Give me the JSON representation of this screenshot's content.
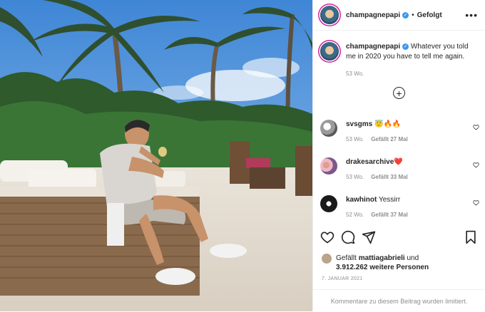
{
  "header": {
    "username": "champagnepapi",
    "separator": "•",
    "follow_status": "Gefolgt",
    "more_icon": "more-dots-icon"
  },
  "caption": {
    "username": "champagnepapi",
    "text": "Whatever you told me in 2020 you have to tell me again.",
    "time": "53 Wo."
  },
  "load_more_icon": "plus-circle-icon",
  "comments": [
    {
      "username": "svsgms",
      "text": "😇🔥🔥",
      "time": "53 Wo.",
      "likes": "Gefällt 27 Mal"
    },
    {
      "username": "drakesarchive",
      "text": "❤️",
      "time": "53 Wo.",
      "likes": "Gefällt 33 Mal"
    },
    {
      "username": "kawhinot",
      "text": "Yessirr",
      "time": "52 Wo.",
      "likes": "Gefällt 37 Mal"
    }
  ],
  "actions": {
    "like_icon": "heart-icon",
    "comment_icon": "comment-icon",
    "share_icon": "share-icon",
    "save_icon": "bookmark-icon"
  },
  "likes": {
    "prefix": "Gefällt",
    "user": "mattiagabrieli",
    "mid": "und",
    "count": "3.912.262",
    "suffix": "weitere Personen"
  },
  "date": "7. JANUAR 2021",
  "comment_box": {
    "text": "Kommentare zu diesem Beitrag wurden limitiert."
  },
  "colors": {
    "verified": "#3897f0",
    "muted": "#8e8e8e",
    "text": "#262626"
  }
}
